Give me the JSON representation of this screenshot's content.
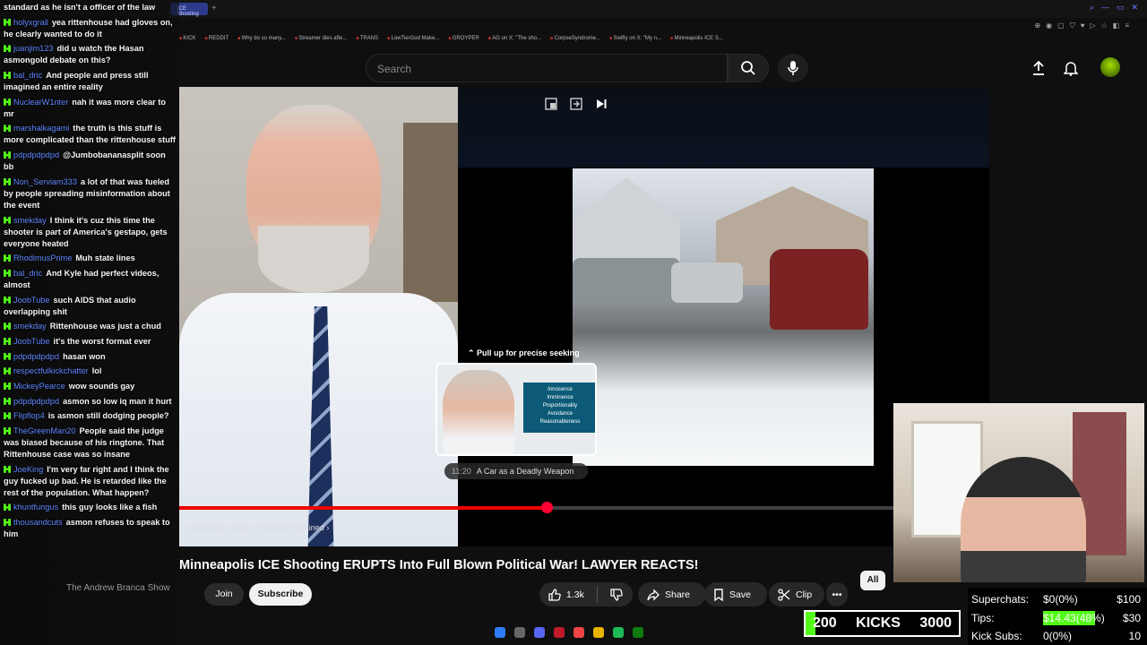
{
  "browser": {
    "active_tab": "ICE Shooting",
    "bookmarks": [
      "KICK",
      "REDDIT",
      "Why do so many...",
      "Streamer dies afte...",
      "TRANS",
      "LowTierGod Make...",
      "GROYPER",
      "AG on X: \"The sho...",
      "CorpseSyndrome...",
      "Swifty on X: \"My n...",
      "Minneapolis ICE S..."
    ]
  },
  "search": {
    "placeholder": "Search"
  },
  "player": {
    "seek_hint": "Pull up for precise seeking",
    "preview_time": "11:20",
    "preview_title": "A Car as a Deadly Weapon",
    "preview_slide": [
      "Innocence",
      "Imminence",
      "Proportionality",
      "Avoidance",
      "Reasonableness"
    ],
    "chapter": "Minnesota's Duty to Retreat Explained",
    "progress_played": 0.453,
    "accent": "#ff0000"
  },
  "video": {
    "title": "Minneapolis ICE Shooting ERUPTS Into Full Blown Political War! LAWYER REACTS!",
    "channel": "The Andrew Branca Show",
    "join": "Join",
    "subscribe": "Subscribe",
    "likes": "1.3k",
    "share": "Share",
    "save": "Save",
    "clip": "Clip",
    "chip_all": "All"
  },
  "chat": [
    {
      "user": "",
      "text": "standard as he isn't a officer of the law"
    },
    {
      "user": "holyxgrail",
      "text": "yea rittenhouse had gloves on, he clearly wanted to do it"
    },
    {
      "user": "juanjim123",
      "text": "did u watch the Hasan asmongold debate on this?"
    },
    {
      "user": "bal_dric",
      "text": "And people and press still imagined an entire reality"
    },
    {
      "user": "NuclearW1nter",
      "text": "nah it was more clear to mr"
    },
    {
      "user": "marshalkagami",
      "text": "the truth is this stuff is more complicated than the rittenhouse stuff"
    },
    {
      "user": "pdpdpdpdpd",
      "text": "@Jumbobananasplit soon bb"
    },
    {
      "user": "Non_Serviam333",
      "text": "a lot of that was fueled by people spreading misinformation about the event"
    },
    {
      "user": "smekday",
      "text": "I think it's cuz this time the shooter is part of America's gestapo, gets everyone heated"
    },
    {
      "user": "RhodimusPrime",
      "text": "Muh state lines"
    },
    {
      "user": "bal_dric",
      "text": "And Kyle had perfect videos, almost"
    },
    {
      "user": "JoobTube",
      "text": "such AIDS that audio overlapping shit"
    },
    {
      "user": "smekday",
      "text": "Rittenhouse was just a chud"
    },
    {
      "user": "JoobTube",
      "text": "it's the worst format ever"
    },
    {
      "user": "pdpdpdpdpd",
      "text": "hasan won"
    },
    {
      "user": "respectfulkickchatter",
      "text": "lol"
    },
    {
      "user": "MickeyPearce",
      "text": "wow sounds gay"
    },
    {
      "user": "pdpdpdpdpd",
      "text": "asmon so low iq man it hurt"
    },
    {
      "user": "Flipflop4",
      "text": "is asmon still dodging people?"
    },
    {
      "user": "TheGreenMan20",
      "text": "People said the judge was biased because of his ringtone. That Rittenhouse case was so insane"
    },
    {
      "user": "JoeKing",
      "text": "I'm very far right and I think the guy fucked up bad. He is retarded like the rest of the population. What happen?"
    },
    {
      "user": "khuntfungus",
      "text": "this guy looks like a fish"
    },
    {
      "user": "thousandcuts",
      "text": "asmon refuses to speak to him"
    }
  ],
  "stats": {
    "kicks_current": "200",
    "kicks_label": "KICKS",
    "kicks_goal": "3000",
    "kicks_progress": 0.067,
    "superchats_label": "Superchats:",
    "superchats_value": "$0(0%)",
    "superchats_goal": "$100",
    "superchats_progress": 0,
    "tips_label": "Tips:",
    "tips_value": "$14.43(48%)",
    "tips_goal": "$30",
    "tips_progress": 0.48,
    "kicksubs_label": "Kick Subs:",
    "kicksubs_value": "0(0%)",
    "kicksubs_goal": "10",
    "kicksubs_progress": 0
  },
  "colors": {
    "kick_green": "#53fc18",
    "chat_user": "#5e86ff"
  }
}
